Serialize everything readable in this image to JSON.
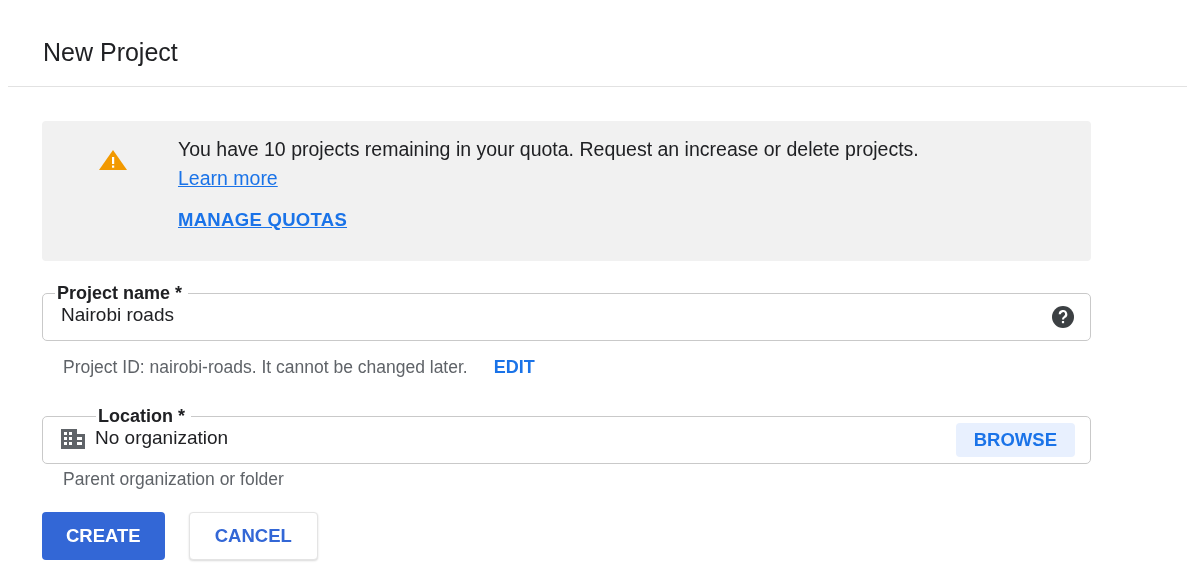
{
  "title": "New Project",
  "notice": {
    "text": "You have 10 projects remaining in your quota. Request an increase or delete projects.",
    "link": "Learn more",
    "action": "MANAGE QUOTAS"
  },
  "project_name": {
    "label": "Project name *",
    "value": "Nairobi roads",
    "helper": "Project ID: nairobi-roads. It cannot be changed later.",
    "helper_action": "EDIT"
  },
  "location": {
    "label": "Location *",
    "value": "No organization",
    "action": "BROWSE",
    "helper": "Parent organization or folder"
  },
  "buttons": [
    {
      "label": "CREATE",
      "kind": "primary"
    },
    {
      "label": "CANCEL",
      "kind": "secondary"
    }
  ]
}
